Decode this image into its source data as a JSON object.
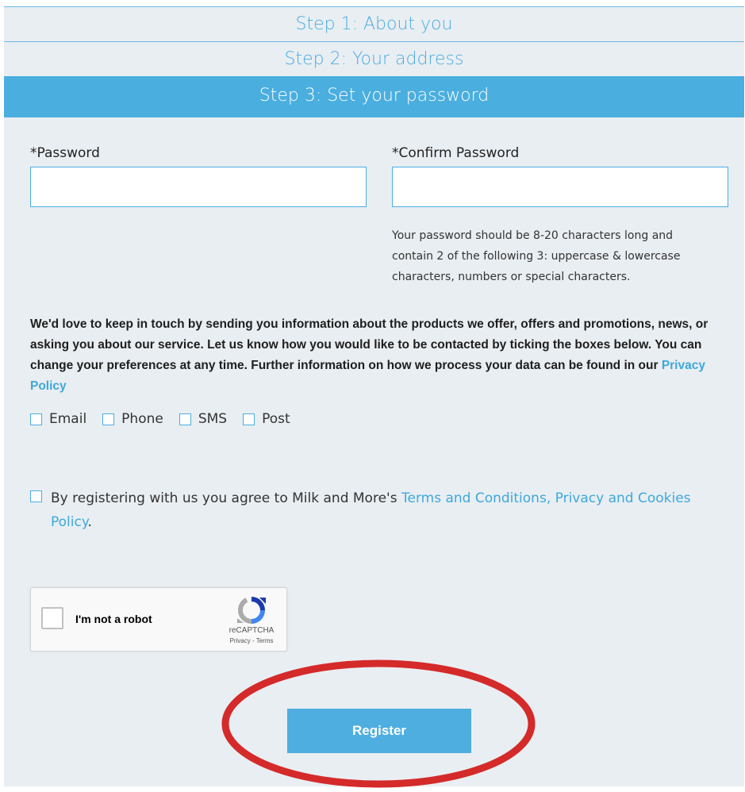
{
  "steps": {
    "step1": "Step 1: About you",
    "step2": "Step 2: Your address",
    "step3": "Step 3: Set your password"
  },
  "form": {
    "password_label": "*Password",
    "password_value": "",
    "confirm_label": "*Confirm Password",
    "confirm_value": "",
    "hint": "Your password should be 8-20 characters long and contain 2 of the following 3: uppercase & lowercase characters, numbers or special characters."
  },
  "consent": {
    "text": "We'd love to keep in touch by sending you information about the products we offer, offers and promotions, news, or asking you about our service. Let us know how you would like to be contacted by ticking the boxes below. You can change your preferences at any time. Further information on how we process your data can be found in our",
    "link": "Privacy Policy",
    "options": [
      {
        "label": "Email",
        "checked": false
      },
      {
        "label": "Phone",
        "checked": false
      },
      {
        "label": "SMS",
        "checked": false
      },
      {
        "label": "Post",
        "checked": false
      }
    ]
  },
  "terms": {
    "checked": false,
    "text": "By registering with us you agree to Milk and More's",
    "link": "Terms and Conditions, Privacy and Cookies Policy",
    "suffix": "."
  },
  "captcha": {
    "label": "I'm not a robot",
    "brand": "reCAPTCHA",
    "links": "Privacy - Terms",
    "checked": false
  },
  "register_label": "Register",
  "colors": {
    "accent": "#4aaedf",
    "background": "#e9eef2",
    "highlight": "#d42a2a"
  }
}
